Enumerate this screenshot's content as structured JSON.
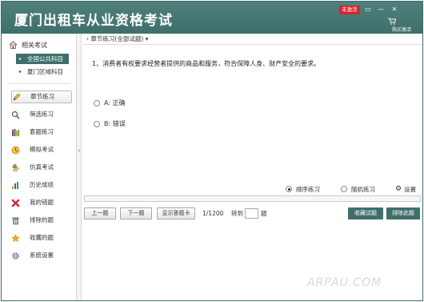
{
  "app": {
    "title": "厦门出租车从业资格考试",
    "unactivated_badge": "未激活"
  },
  "window_controls": {
    "menu_glyph": "▭",
    "minimize_glyph": "—",
    "close_glyph": "✕"
  },
  "buy": {
    "label": "购买激活"
  },
  "sidebar": {
    "header": "相关考试",
    "categories": [
      {
        "label": "全国公共科目",
        "active": true
      },
      {
        "label": "厦门区域科目",
        "active": false
      }
    ],
    "menu": [
      {
        "label": "章节练习",
        "icon": "pencil-icon"
      },
      {
        "label": "筛选练习",
        "icon": "magnifier-icon"
      },
      {
        "label": "套题练习",
        "icon": "books-icon"
      },
      {
        "label": "模拟考试",
        "icon": "clock-icon"
      },
      {
        "label": "仿真考试",
        "icon": "hand-icon"
      },
      {
        "label": "历史成绩",
        "icon": "bar-chart-icon"
      },
      {
        "label": "我的错题",
        "icon": "red-x-icon"
      },
      {
        "label": "排除的题",
        "icon": "trash-icon"
      },
      {
        "label": "收藏的题",
        "icon": "star-icon"
      },
      {
        "label": "系统设置",
        "icon": "gear-icon"
      }
    ]
  },
  "breadcrumb": {
    "label": "章节练习(全部试题)"
  },
  "question": {
    "text": "1、消费者有权要求经营者提供的商品和服务，符合保障人身、财产安全的要求。",
    "options": [
      {
        "label": "A: 正确",
        "selected": false
      },
      {
        "label": "B: 错误",
        "selected": false
      }
    ]
  },
  "mode": {
    "sequential": "顺序练习",
    "random": "随机练习",
    "settings": "设置",
    "selected": "sequential"
  },
  "progress": {
    "fraction": 0.0
  },
  "nav": {
    "prev": "上一题",
    "next": "下一题",
    "show_card": "显示答题卡",
    "page": "1/1200",
    "goto": "转到",
    "goto_suffix": "题",
    "goto_value": "",
    "collect": "收藏试题",
    "exclude": "排除此题"
  },
  "watermark": "ARPAU.COM",
  "colors": {
    "accent": "#3e6f6b",
    "badge_red": "#d9232d"
  }
}
